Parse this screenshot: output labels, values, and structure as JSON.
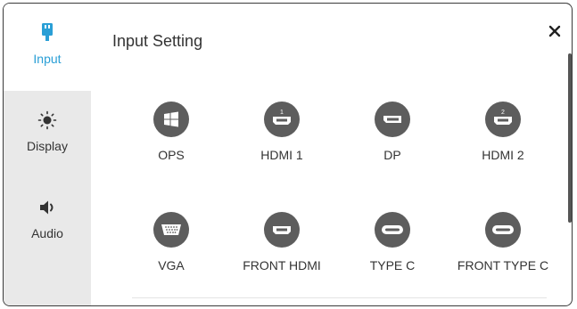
{
  "sidebar": {
    "items": [
      {
        "label": "Input",
        "icon": "input-plug-icon",
        "active": true
      },
      {
        "label": "Display",
        "icon": "brightness-icon",
        "active": false
      },
      {
        "label": "Audio",
        "icon": "speaker-icon",
        "active": false
      }
    ]
  },
  "header": {
    "title": "Input Setting",
    "close_icon": "close-icon"
  },
  "sources": [
    {
      "label": "OPS",
      "icon": "windows-icon"
    },
    {
      "label": "HDMI 1",
      "icon": "hdmi-1-icon",
      "port_number": "1"
    },
    {
      "label": "DP",
      "icon": "displayport-icon"
    },
    {
      "label": "HDMI 2",
      "icon": "hdmi-2-icon",
      "port_number": "2"
    },
    {
      "label": "VGA",
      "icon": "vga-icon"
    },
    {
      "label": "FRONT HDMI",
      "icon": "hdmi-icon"
    },
    {
      "label": "TYPE C",
      "icon": "usb-c-icon"
    },
    {
      "label": "FRONT TYPE C",
      "icon": "usb-c-icon"
    }
  ],
  "colors": {
    "accent": "#2a9fd6",
    "icon_circle": "#5d5d5d",
    "sidebar_bg": "#e9e9e9",
    "text": "#333333"
  }
}
